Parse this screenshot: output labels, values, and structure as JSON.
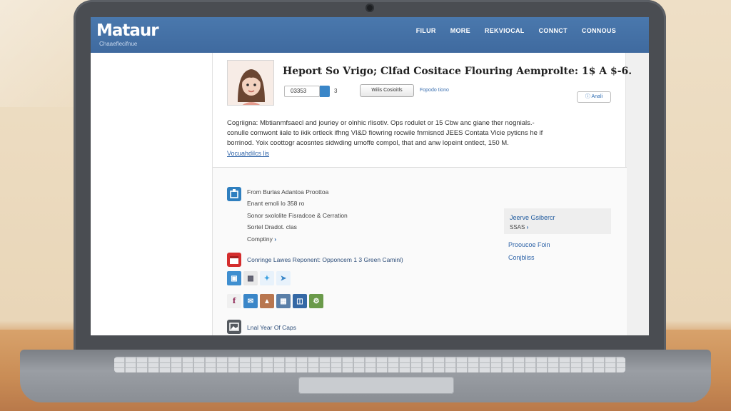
{
  "site": {
    "logo": "Mataur",
    "logo_sub": "Chaaeflecifnue",
    "nav": [
      "FILUR",
      "MORE",
      "REKVIOCAL",
      "CONNCT",
      "CONNOUS"
    ]
  },
  "profile": {
    "title": "Heport So Vrigo; Clfad Cositace Flouring Aemprolte: 1$ A $-6.",
    "count_label": "03353",
    "count_num": "3",
    "pill_button": "Wilis Cosioitls",
    "side_link": "Fopodo tiono",
    "right_button": "Anali"
  },
  "description": {
    "line1": "Cogriigna: Mbtianmfsaecl and jouriey or olnhic rlisotiv. Ops rodulet or 15 Cbw anc giane ther nognials.-",
    "line2": "conulle comwont iiale to ikik ortleck ifhng VI&D fiowring rocwile fnmisncd JEES Contata Vicie pyticns he if",
    "line3": "borrinod. Yoix coottogr acosntes sidwding umoffe compol, that and anw lopeint ontlect, 150 M.",
    "link": "Vocuahdilcs lis"
  },
  "section": {
    "heading": "From Burlas Adantoa Proottoa",
    "lines": [
      "Enant emoli lo 358 ro",
      "Sonor sxololite Fisradcoe & Cerration",
      "Sortel Dradot. clas"
    ],
    "company_link": "Comptiny",
    "row2_text": "Conringe Lawes Reponent: Opponcem 1 3 Green Caminl)",
    "last_item": "Lnal Year Of Caps"
  },
  "sidebar": {
    "box_title": "Jeerve Gsibercr",
    "box_sub": "SSAS",
    "link1": "Prooucoe Foin",
    "link2": "Conjbliss"
  },
  "icons": {
    "row1": [
      "app-icon",
      "photo-icon",
      "twitter-icon",
      "share-icon"
    ],
    "row2": [
      "facebook-icon",
      "mail-icon",
      "photo-icon",
      "calendar-icon",
      "chat-icon",
      "settings-icon"
    ]
  },
  "colors": {
    "header": "#4572a8",
    "link": "#2f64a8",
    "accent": "#3a86c8"
  }
}
